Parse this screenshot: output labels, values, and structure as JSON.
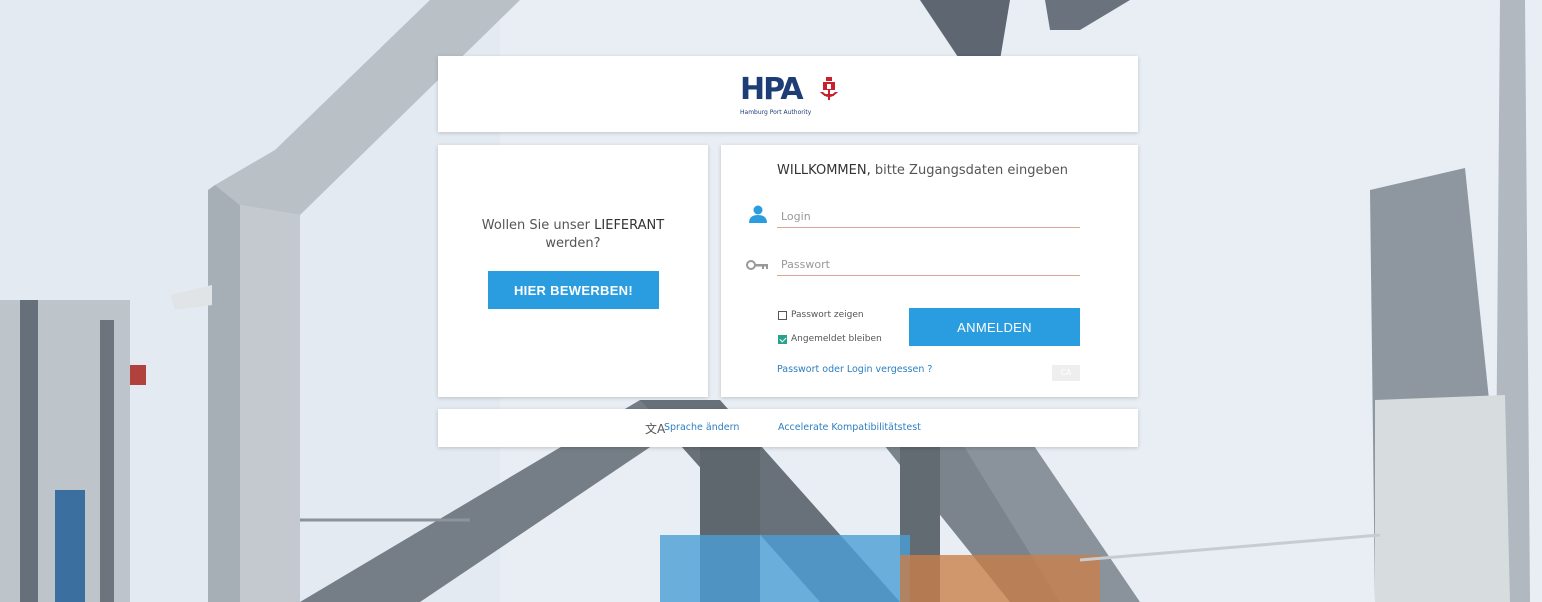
{
  "logo": {
    "wordmark": "HPA",
    "subtitle": "Hamburg Port Authority"
  },
  "supplier": {
    "question_prefix": "Wollen Sie unser ",
    "question_highlight": "LIEFERANT",
    "question_suffix": "werden?",
    "apply_label": "HIER BEWERBEN!"
  },
  "login": {
    "welcome_strong": "WILLKOMMEN,",
    "welcome_rest": " bitte Zugangsdaten eingeben",
    "login_placeholder": "Login",
    "password_placeholder": "Passwort",
    "show_password_label": "Passwort zeigen",
    "stay_logged_in_label": "Angemeldet bleiben",
    "submit_label": "ANMELDEN",
    "forgot_label": "Passwort oder Login vergessen ?",
    "badge_label": "CA",
    "show_password_checked": false,
    "stay_logged_in_checked": true
  },
  "footer": {
    "language_label": "Sprache ändern",
    "compat_label": "Accelerate Kompatibilitätstest"
  },
  "colors": {
    "accent": "#2a9de0",
    "brand": "#1d3d77",
    "link": "#2b7fc2",
    "check": "#27a38b"
  },
  "icons": {
    "user": "user-icon",
    "key": "key-icon",
    "language": "translate-icon",
    "crest": "harbor-crest-icon"
  }
}
